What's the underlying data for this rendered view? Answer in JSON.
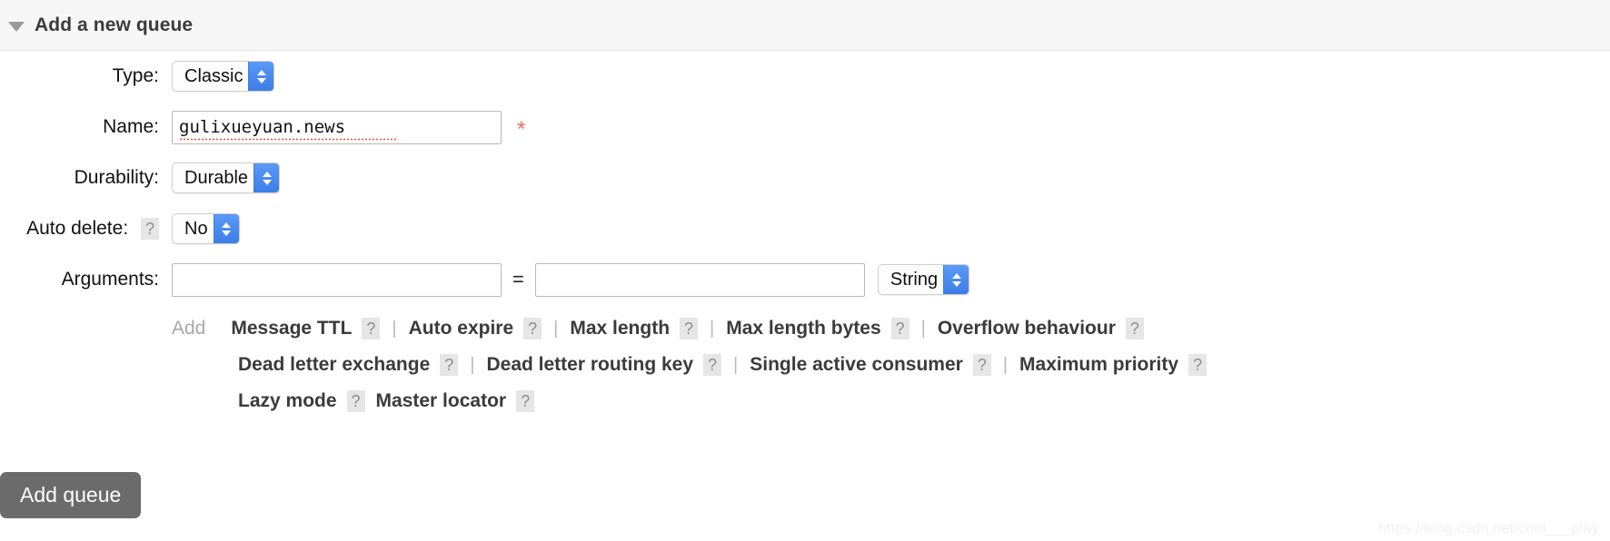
{
  "section": {
    "title": "Add a new queue",
    "collapse_icon": "triangle-down-icon",
    "expanded": true
  },
  "form": {
    "type": {
      "label": "Type:",
      "value": "Classic"
    },
    "name": {
      "label": "Name:",
      "value": "gulixueyuan.news",
      "placeholder": "",
      "required_marker": "*"
    },
    "durability": {
      "label": "Durability:",
      "value": "Durable"
    },
    "auto_delete": {
      "label": "Auto delete:",
      "help": "?",
      "value": "No"
    },
    "arguments": {
      "label": "Arguments:",
      "key_value": "",
      "key_placeholder": "",
      "equals": "=",
      "value_value": "",
      "value_placeholder": "",
      "type_value": "String"
    }
  },
  "presets": {
    "add_label": "Add",
    "help_glyph": "?",
    "separator": "|",
    "rows": [
      {
        "indent": false,
        "items": [
          {
            "label": "Message TTL",
            "help": true,
            "separator_after": true
          },
          {
            "label": "Auto expire",
            "help": true,
            "separator_after": true
          },
          {
            "label": "Max length",
            "help": true,
            "separator_after": true
          },
          {
            "label": "Max length bytes",
            "help": true,
            "separator_after": true
          },
          {
            "label": "Overflow behaviour",
            "help": true,
            "separator_after": false
          }
        ]
      },
      {
        "indent": true,
        "items": [
          {
            "label": "Dead letter exchange",
            "help": true,
            "separator_after": true
          },
          {
            "label": "Dead letter routing key",
            "help": true,
            "separator_after": true
          },
          {
            "label": "Single active consumer",
            "help": true,
            "separator_after": true
          },
          {
            "label": "Maximum priority",
            "help": true,
            "separator_after": false
          }
        ]
      },
      {
        "indent": true,
        "items": [
          {
            "label": "Lazy mode",
            "help": true,
            "separator_after": false
          },
          {
            "label": "Master locator",
            "help": true,
            "separator_after": false
          }
        ]
      }
    ]
  },
  "submit": {
    "label": "Add queue"
  },
  "watermark": {
    "text": "https://blog.csdn.net/cold___play"
  },
  "colors": {
    "header_bg": "#f7f7f7",
    "stepper_blue": "#3d7de8",
    "required_red": "#ef6b5e",
    "submit_gray": "#6b6b6b",
    "help_chip_bg": "#e6e6e6"
  }
}
